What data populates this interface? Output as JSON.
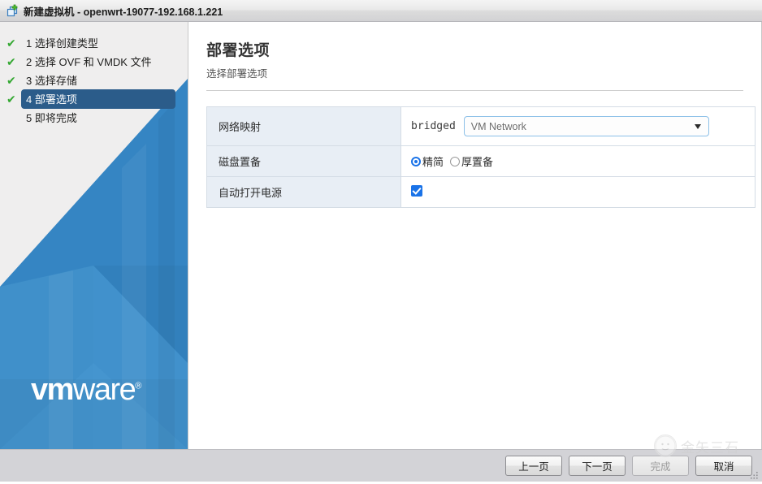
{
  "window": {
    "title": "新建虚拟机 - openwrt-19077-192.168.1.221",
    "icon": "new-vm-icon"
  },
  "wizard": {
    "steps": [
      {
        "number": "1",
        "label": "1 选择创建类型",
        "completed": true,
        "active": false
      },
      {
        "number": "2",
        "label": "2 选择 OVF 和 VMDK 文件",
        "completed": true,
        "active": false
      },
      {
        "number": "3",
        "label": "3 选择存储",
        "completed": true,
        "active": false
      },
      {
        "number": "4",
        "label": "4 部署选项",
        "completed": true,
        "active": true
      },
      {
        "number": "5",
        "label": "5 即将完成",
        "completed": false,
        "active": false
      }
    ],
    "check_glyph": "✔",
    "brand": {
      "vm": "vm",
      "ware": "ware",
      "registered": "®"
    }
  },
  "page": {
    "title": "部署选项",
    "subtitle": "选择部署选项"
  },
  "form": {
    "rows": [
      {
        "label": "网络映射",
        "type": "network",
        "source_network": "bridged",
        "selected_network": "VM Network"
      },
      {
        "label": "磁盘置备",
        "type": "radio",
        "options": [
          {
            "label": "精简",
            "selected": true
          },
          {
            "label": "厚置备",
            "selected": false
          }
        ]
      },
      {
        "label": "自动打开电源",
        "type": "checkbox",
        "checked": true
      }
    ]
  },
  "footer": {
    "buttons": [
      {
        "label": "上一页",
        "name": "back-button",
        "disabled": false
      },
      {
        "label": "下一页",
        "name": "next-button",
        "disabled": false
      },
      {
        "label": "完成",
        "name": "finish-button",
        "disabled": true
      },
      {
        "label": "取消",
        "name": "cancel-button",
        "disabled": false
      }
    ]
  },
  "watermark": {
    "text": "金矢三石"
  },
  "colors": {
    "accent_blue": "#1a73e8",
    "step_active_bg": "#2b5c8a",
    "check_green": "#34a832",
    "label_cell_bg": "#e8eef5",
    "select_border": "#8cc0e8",
    "sidebar_blue": "#3080c0"
  }
}
